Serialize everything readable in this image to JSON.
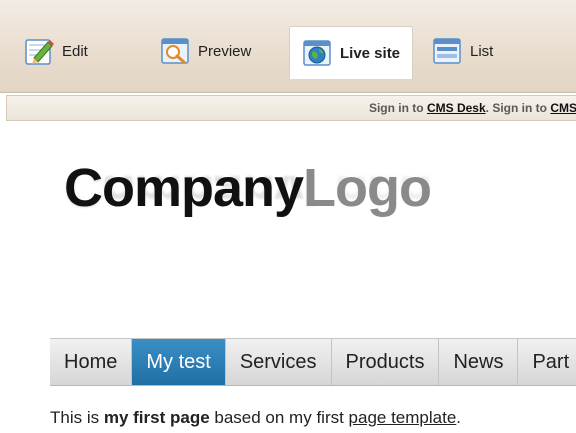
{
  "toolbar": {
    "modes": [
      {
        "label": "Edit",
        "icon": "edit-pencil-icon"
      },
      {
        "label": "Preview",
        "icon": "preview-magnifier-icon"
      },
      {
        "label": "Live site",
        "icon": "globe-icon",
        "active": true
      },
      {
        "label": "List",
        "icon": "list-icon"
      }
    ]
  },
  "signbar": {
    "prefix1": "Sign in to ",
    "link1": "CMS Desk",
    "middle": ". Sign in to ",
    "link2": "CMS"
  },
  "logo": {
    "company": "Company",
    "logo_word": "Logo"
  },
  "menu": {
    "items": [
      "Home",
      "My test",
      "Services",
      "Products",
      "News",
      "Part"
    ],
    "active_index": 1
  },
  "content": {
    "text1": "This is ",
    "bold": "my first page",
    "text2": " based on my first ",
    "link": "page template",
    "text3": "."
  },
  "colors": {
    "menu_active": "#1f6fa5",
    "toolbar_bg": "#e8dccd",
    "logo_dark": "#111111",
    "logo_grey": "#8a8a8a"
  }
}
